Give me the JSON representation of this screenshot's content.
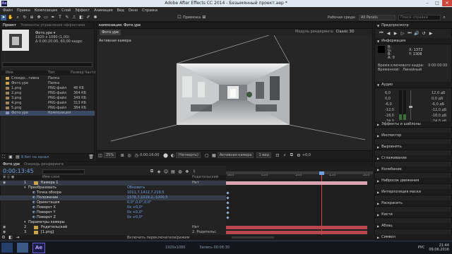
{
  "window": {
    "title": "Adobe After Effects CC 2014 - Безымянный проект.aep *",
    "app_icon": "Ae"
  },
  "menu": [
    "Файл",
    "Правка",
    "Композиция",
    "Слой",
    "Эффект",
    "Анимация",
    "Вид",
    "Окно",
    "Справка"
  ],
  "toolbar": {
    "snap_label": "Привязка",
    "workspace_label": "Рабочая среда:",
    "workspace_value": "All Panels",
    "search_placeholder": "Поиск справки"
  },
  "project": {
    "tab": "Проект",
    "tab2": "Элементы управления эффектами",
    "item_name": "Фото.урe ▾",
    "item_info": [
      "1920 x 1080 (1,00)",
      "Δ 0:00:20:00, 60,00 кадрс"
    ],
    "col_name": "Имя",
    "col_type": "Тип",
    "col_size": "Размер",
    "col_rate": "Частота",
    "items": [
      {
        "name": "Слоидо...тивка",
        "type": "Папка",
        "size": "",
        "icon": "folder"
      },
      {
        "name": "Фото.урe",
        "type": "Папка",
        "size": "",
        "icon": "folder"
      },
      {
        "name": "1.png",
        "type": "PNG-файл",
        "size": "46 КБ",
        "icon": "image"
      },
      {
        "name": "2.png",
        "type": "PNG-файл",
        "size": "364 КБ",
        "icon": "image"
      },
      {
        "name": "3.png",
        "type": "PNG-файл",
        "size": "349 КБ",
        "icon": "image"
      },
      {
        "name": "4.png",
        "type": "PNG-файл",
        "size": "313 КБ",
        "icon": "image"
      },
      {
        "name": "5.png",
        "type": "PNG-файл",
        "size": "384 КБ",
        "icon": "image"
      },
      {
        "name": "Фото.урe",
        "type": "Композиция",
        "size": "",
        "icon": "comp"
      }
    ],
    "footer": "8 бит на канал"
  },
  "composition": {
    "tab_panel": "композиция: Фото.урe",
    "tab": "Фото.урe",
    "view_label": "Активная камера",
    "renderer_label": "Модуль рендеринга:",
    "renderer_value": "Classic 3D",
    "zoom": "25%",
    "timecode": "0:00:16:00",
    "resolution": "(Четверть)",
    "camera": "Активная камера",
    "views": "1 вид",
    "offset": "+0,0"
  },
  "right_panel": {
    "preview": "Предпросмотр",
    "info": "Информация",
    "info_x": "X: 1372",
    "info_y": "Y: 1308",
    "info_rgb": [
      "R:",
      "G:",
      "B:",
      "A: 0"
    ],
    "info_time": "Время ключевого кадра:",
    "info_time_val": "0:00:00:00",
    "info_interp": "Временной:",
    "info_interp_val": "Линейный",
    "audio": "Аудио",
    "audio_levels": [
      "6,0",
      "0,0",
      "-6,0",
      "-12,0",
      "-18,0",
      "-24,0"
    ],
    "audio_db": [
      "12,0 дБ",
      "0,0 дБ",
      "-6,0 дБ",
      "-12,0 дБ",
      "-18,0 дБ",
      "-24,0 дБ"
    ],
    "sections": [
      "Эффекты и шаблоны",
      "Инспектор",
      "Выровнять",
      "Сглаживание",
      "Колебание",
      "Набросок движения",
      "Интерполяция маски",
      "Раскрасить",
      "Кисти",
      "Абзац",
      "Символ"
    ]
  },
  "timeline": {
    "tab": "Фото.урe",
    "tab2": "Очередь рендеринга",
    "timecode": "0:00:13:45",
    "fps": "00825 (60,00 кадрс)",
    "search_placeholder": "",
    "col_name": "Имя слоя",
    "col_parent": "Родительский",
    "ruler": [
      "00s",
      "05s",
      "10s",
      "15s",
      "20s"
    ],
    "layers": [
      {
        "num": "1",
        "name": "Камера 1",
        "parent": "Нет",
        "kind": "layer",
        "sel": true
      },
      {
        "num": "",
        "name": "Преобразовать",
        "parent": "",
        "kind": "group",
        "value": "Обновить"
      },
      {
        "num": "",
        "name": "Точка обзора",
        "parent": "",
        "kind": "prop",
        "value": "1011,7,1412,7,219,5"
      },
      {
        "num": "",
        "name": "Положение",
        "parent": "",
        "kind": "prop",
        "value": "1578,7,1019,2,-1000,5",
        "sel": true
      },
      {
        "num": "",
        "name": "Ориентация",
        "parent": "",
        "kind": "prop",
        "value": "0,0°,0,0°,0,0°"
      },
      {
        "num": "",
        "name": "Поворот X",
        "parent": "",
        "kind": "prop",
        "value": "0x +0,0°"
      },
      {
        "num": "",
        "name": "Поворот Y",
        "parent": "",
        "kind": "prop",
        "value": "0x +0,0°"
      },
      {
        "num": "",
        "name": "Поворот Z",
        "parent": "",
        "kind": "prop",
        "value": "0x +0,0°"
      },
      {
        "num": "",
        "name": "Параметры камеры",
        "parent": "",
        "kind": "group",
        "value": ""
      },
      {
        "num": "2",
        "name": "Родительский",
        "parent": "Нет",
        "kind": "layer",
        "sel": false
      },
      {
        "num": "3",
        "name": "[1.png]",
        "parent": "2. Родительс",
        "kind": "layer",
        "sel": false
      }
    ],
    "footer": "Включить переключатели/режим"
  },
  "taskbar": {
    "clock": "21:44",
    "date": "09.06.2016",
    "lang": "РУС",
    "items": [
      "1920x1080",
      "Запись 00:08:30"
    ]
  },
  "colors": {
    "accent": "#3a5e90",
    "workspace": "#1e1e1e",
    "keyframe": "#8fb0d8",
    "timeline_red": "#d9443a",
    "bar_red": "#b8484e",
    "layer_pink": "#d9a3b2"
  }
}
